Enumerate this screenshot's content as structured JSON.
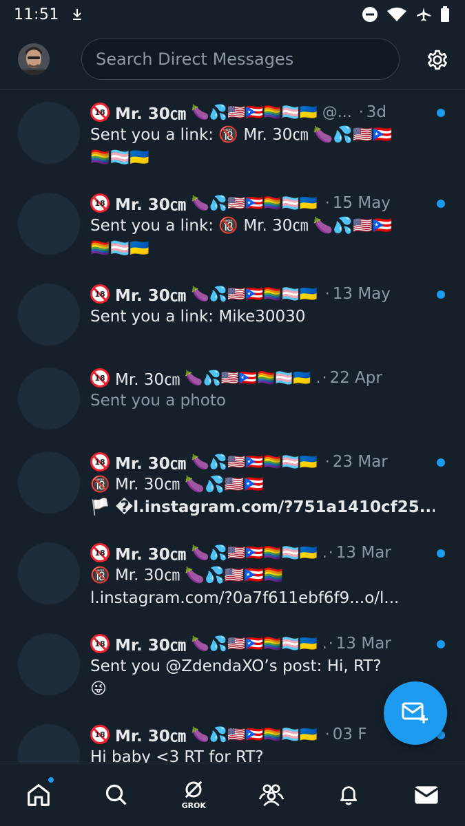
{
  "status": {
    "time": "11:51",
    "icons": [
      "download-icon",
      "dnd-icon",
      "wifi-icon",
      "airplane-icon",
      "battery-icon"
    ]
  },
  "header": {
    "search_placeholder": "Search Direct Messages"
  },
  "conversations": [
    {
      "badge": "18",
      "name": "Mr. 30㎝",
      "name_emojis": "🍆💦🇺🇸🇵🇷🏳️‍🌈🏳️‍⚧️🇺🇦",
      "handle": "@...",
      "time": "3d",
      "message_line1": "Sent you a link: 🔞 Mr. 30㎝ 🍆💦🇺🇸🇵🇷",
      "message_line2": "🏳️‍🌈🏳️‍⚧️🇺🇦",
      "unread": true,
      "bold": true
    },
    {
      "badge": "18",
      "name": "Mr. 30㎝",
      "name_emojis": "🍆💦🇺🇸🇵🇷🏳️‍🌈🏳️‍⚧️🇺🇦",
      "handle": "",
      "time": "15 May",
      "message_line1": "Sent you a link: 🔞 Mr. 30㎝ 🍆💦🇺🇸🇵🇷",
      "message_line2": "🏳️‍🌈🏳️‍⚧️🇺🇦",
      "unread": true,
      "bold": true
    },
    {
      "badge": "18",
      "name": "Mr. 30㎝",
      "name_emojis": "🍆💦🇺🇸🇵🇷🏳️‍🌈🏳️‍⚧️🇺🇦",
      "handle": "",
      "time": "13 May",
      "message_line1": "Sent you a link: Mike30030",
      "message_line2": "",
      "unread": true,
      "bold": true
    },
    {
      "badge": "18",
      "name": "Mr. 30㎝",
      "name_emojis": "🍆💦🇺🇸🇵🇷🏳️‍🌈🏳️‍⚧️🇺🇦",
      "handle": ".",
      "time": "22 Apr",
      "message_line1": "Sent you a photo",
      "message_line2": "",
      "unread": false,
      "bold": false
    },
    {
      "badge": "18",
      "name": "Mr. 30㎝",
      "name_emojis": "🍆💦🇺🇸🇵🇷🏳️‍🌈🏳️‍⚧️🇺🇦",
      "handle": "",
      "time": "23 Mar",
      "message_line1": "🔞 Mr. 30㎝ 🍆💦🇺🇸🇵🇷",
      "message_line2": "🏳️ �l.instagram.com/?751a1410cf25...",
      "unread": true,
      "bold": true
    },
    {
      "badge": "18",
      "name": "Mr. 30㎝",
      "name_emojis": "🍆💦🇺🇸🇵🇷🏳️‍🌈🏳️‍⚧️🇺🇦",
      "handle": ".",
      "time": "13 Mar",
      "message_line1": "🔞 Mr. 30㎝ 🍆💦🇺🇸🇵🇷🏳️‍🌈",
      "message_line2": "l.instagram.com/?0a7f611ebf6f9...o/l...",
      "unread": true,
      "bold": true
    },
    {
      "badge": "18",
      "name": "Mr. 30㎝",
      "name_emojis": "🍆💦🇺🇸🇵🇷🏳️‍🌈🏳️‍⚧️🇺🇦",
      "handle": ".",
      "time": "13 Mar",
      "message_line1": "Sent you @ZdendaXO’s post: Hi, RT?",
      "message_line2": "😜",
      "unread": true,
      "bold": true
    },
    {
      "badge": "18",
      "name": "Mr. 30㎝",
      "name_emojis": "🍆💦🇺🇸🇵🇷🏳️‍🌈🏳️‍⚧️🇺🇦",
      "handle": "",
      "time": "03 F",
      "message_line1": "Hi baby <3 RT for RT?",
      "message_line2": "",
      "unread": true,
      "bold": true
    }
  ],
  "nav": {
    "grok_label": "GROK",
    "items": [
      "home-icon",
      "search-icon",
      "grok-icon",
      "communities-icon",
      "notifications-icon",
      "messages-icon"
    ]
  },
  "colors": {
    "background": "#15202b",
    "accent": "#1d9bf0",
    "muted_text": "#8b98a5"
  }
}
